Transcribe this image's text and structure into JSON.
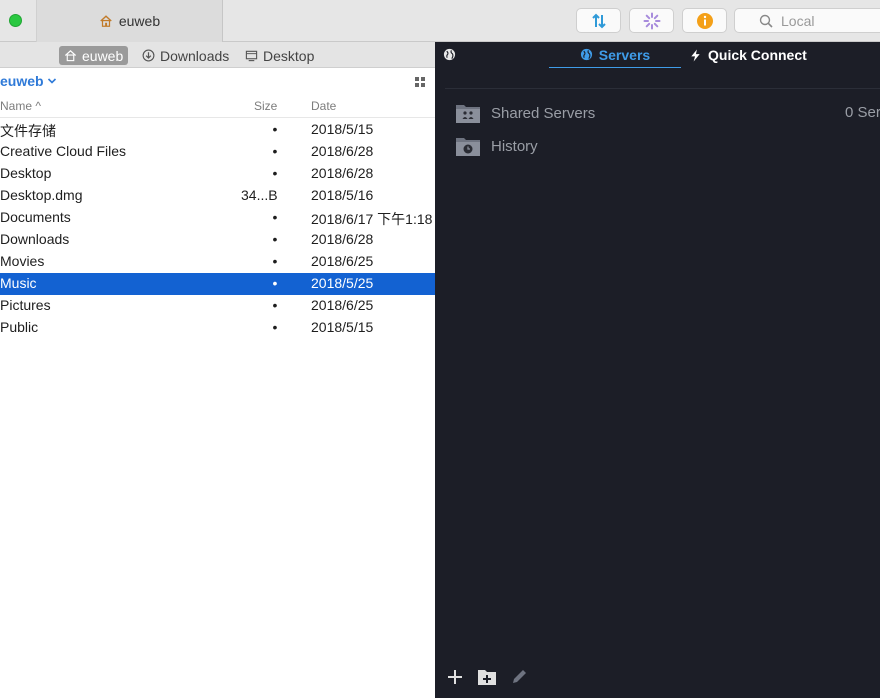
{
  "titlebar": {
    "tab_title": "euweb",
    "search_placeholder": "Local"
  },
  "colors": {
    "selection": "#1362d2",
    "accent": "#3f9ce8",
    "dark_bg": "#1c1e27"
  },
  "pathbar": {
    "items": [
      {
        "label": "euweb",
        "icon": "home-icon"
      },
      {
        "label": "Downloads",
        "icon": "download-icon"
      },
      {
        "label": "Desktop",
        "icon": "desktop-icon"
      }
    ]
  },
  "location": {
    "label": "euweb"
  },
  "columns": {
    "name": "Name",
    "size": "Size",
    "date": "Date"
  },
  "files": [
    {
      "name": "文件存储",
      "size": "•",
      "date": "2018/5/15"
    },
    {
      "name": "Creative Cloud Files",
      "size": "•",
      "date": "2018/6/28"
    },
    {
      "name": "Desktop",
      "size": "•",
      "date": "2018/6/28"
    },
    {
      "name": "Desktop.dmg",
      "size": "34...B",
      "date": "2018/5/16"
    },
    {
      "name": "Documents",
      "size": "•",
      "date": "2018/6/17 下午1:18"
    },
    {
      "name": "Downloads",
      "size": "•",
      "date": "2018/6/28"
    },
    {
      "name": "Movies",
      "size": "•",
      "date": "2018/6/25"
    },
    {
      "name": "Music",
      "size": "•",
      "date": "2018/5/25"
    },
    {
      "name": "Pictures",
      "size": "•",
      "date": "2018/6/25"
    },
    {
      "name": "Public",
      "size": "•",
      "date": "2018/5/15"
    }
  ],
  "selected_file": "Music",
  "right": {
    "tabs": {
      "servers": "Servers",
      "quick_connect": "Quick Connect"
    },
    "shared_servers": "Shared Servers",
    "shared_count": "0 Ser",
    "history": "History"
  }
}
